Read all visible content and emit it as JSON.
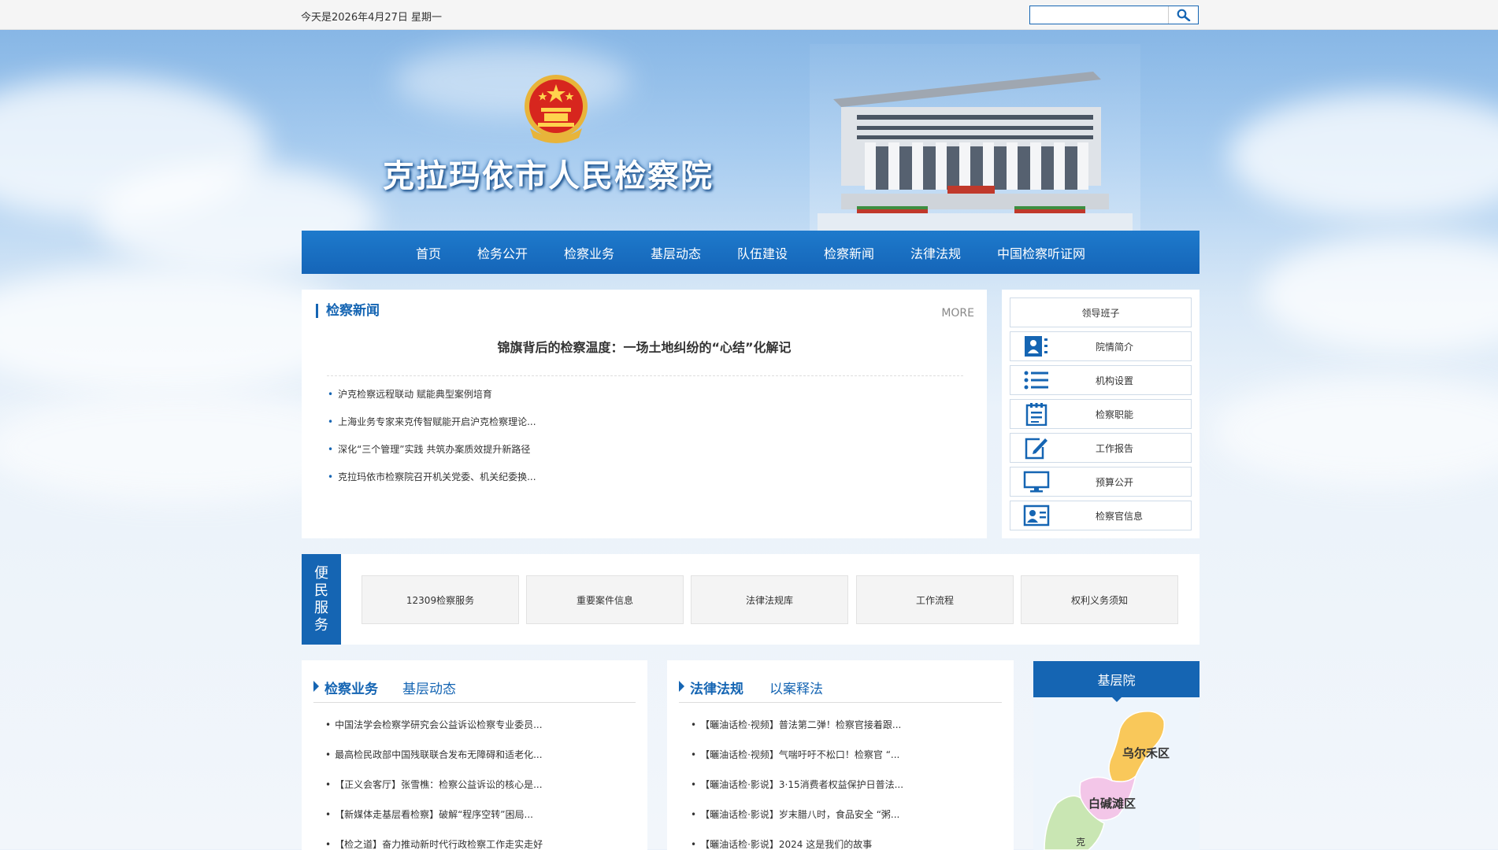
{
  "topbar": {
    "date": "今天是2026年4月27日 星期一",
    "search_placeholder": ""
  },
  "header": {
    "title": "克拉玛依市人民检察院"
  },
  "nav": [
    "首页",
    "检务公开",
    "检察业务",
    "基层动态",
    "队伍建设",
    "检察新闻",
    "法律法规",
    "中国检察听证网"
  ],
  "news": {
    "title": "检察新闻",
    "more": "MORE",
    "headline": "锦旗背后的检察温度：一场土地纠纷的“心结”化解记",
    "items": [
      "沪克检察远程联动 赋能典型案例培育",
      "上海业务专家来克传智赋能开启沪克检察理论...",
      "深化“三个管理”实践 共筑办案质效提升新路径",
      "克拉玛依市检察院召开机关党委、机关纪委换..."
    ]
  },
  "sidebar": {
    "items": [
      {
        "label": "领导班子",
        "icon": "none"
      },
      {
        "label": "院情简介",
        "icon": "id-card-icon"
      },
      {
        "label": "机构设置",
        "icon": "list-icon"
      },
      {
        "label": "检察职能",
        "icon": "notepad-icon"
      },
      {
        "label": "工作报告",
        "icon": "edit-icon"
      },
      {
        "label": "预算公开",
        "icon": "monitor-icon"
      },
      {
        "label": "检察官信息",
        "icon": "profile-card-icon"
      }
    ]
  },
  "service": {
    "tag": [
      "便",
      "民",
      "服",
      "务"
    ],
    "items": [
      "12309检察服务",
      "重要案件信息",
      "法律法规库",
      "工作流程",
      "权利义务须知"
    ]
  },
  "col1": {
    "tab_active": "检察业务",
    "tab_other": "基层动态",
    "items": [
      "中国法学会检察学研究会公益诉讼检察专业委员...",
      "最高检民政部中国残联联合发布无障碍和适老化...",
      "【正义会客厅】张雪樵：检察公益诉讼的核心是...",
      "【新媒体走基层看检察】破解“程序空转”困局...",
      "【检之道】奋力推动新时代行政检察工作走实走好"
    ]
  },
  "col2": {
    "tab_active": "法律法规",
    "tab_other": "以案释法",
    "items": [
      "【曬油话检·视频】普法第二弹！检察官接着跟...",
      "【曬油话检·视频】气喘吁吁不松口！检察官 “...",
      "【曬油话检·影说】3·15消费者权益保护日普法...",
      "【曬油话检·影说】岁末腊八时，食品安全 “粥...",
      "【曬油话检·影说】2024 这是我们的故事"
    ]
  },
  "base": {
    "title": "基层院",
    "map_labels": [
      "乌尔禾区",
      "白碱滩区",
      "克"
    ]
  },
  "colors": {
    "brand_blue": "#1565b3",
    "map_orange": "#f9c85a",
    "map_pink": "#f3c6e8",
    "map_green": "#c9e6b3"
  }
}
